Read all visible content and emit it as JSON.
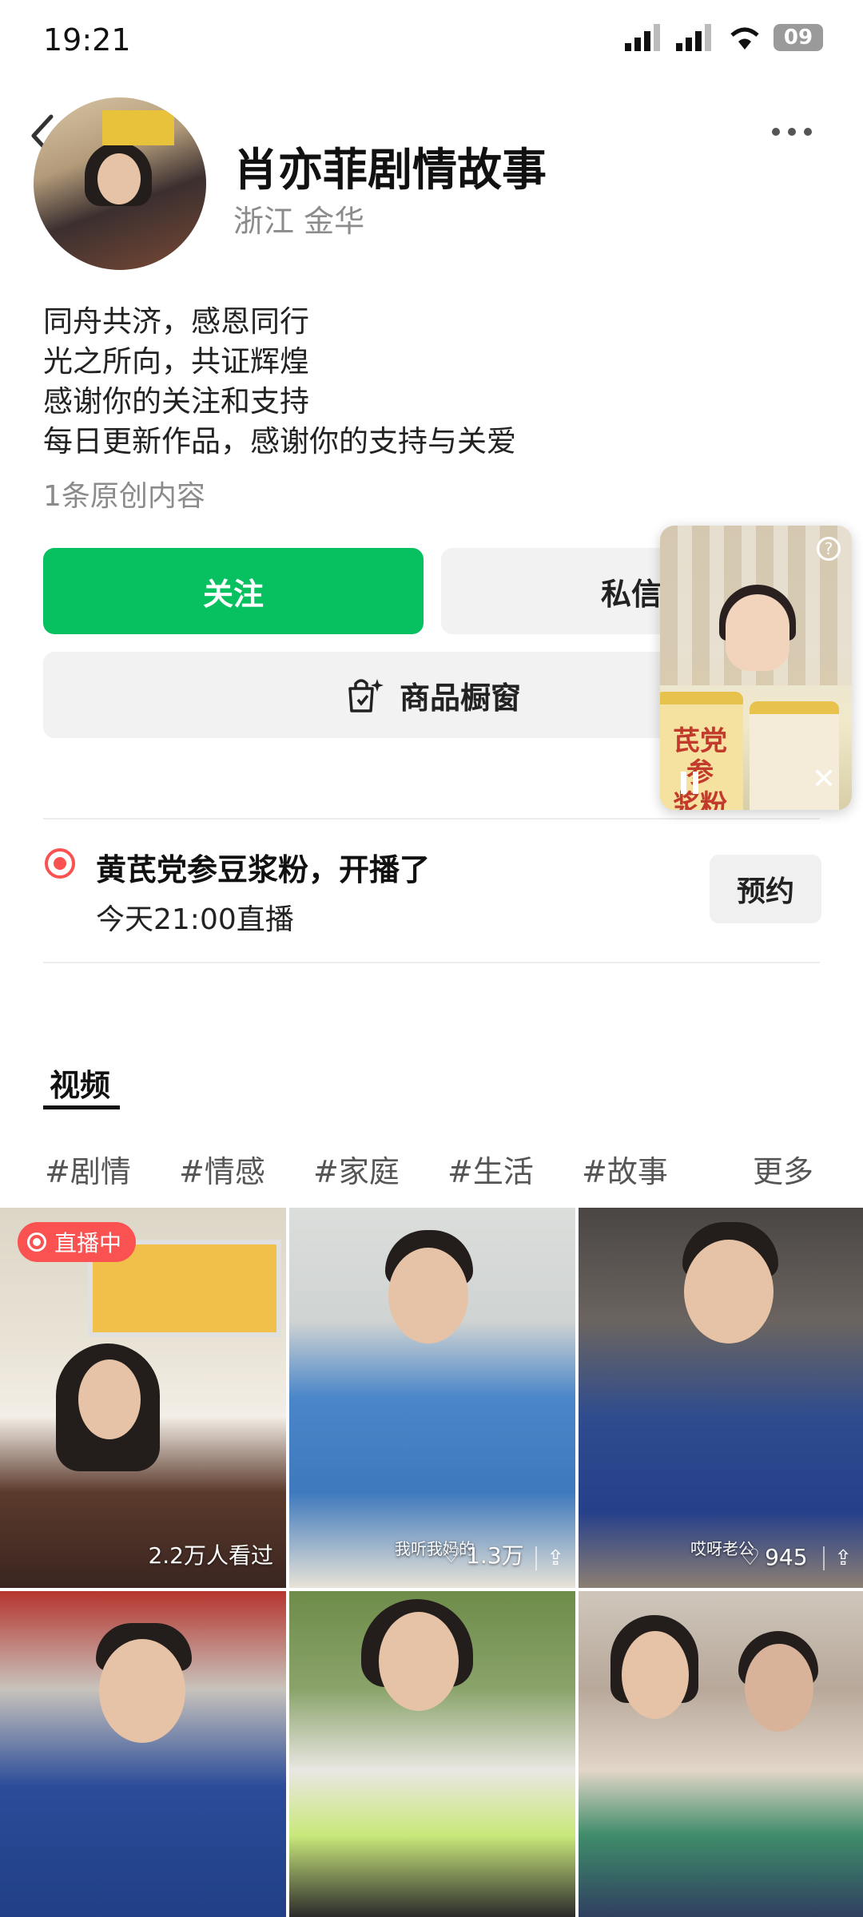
{
  "status_bar": {
    "time": "19:21",
    "battery": "09"
  },
  "profile": {
    "name": "肖亦菲剧情故事",
    "location": "浙江 金华",
    "bio": [
      "同舟共济，感恩同行",
      "光之所向，共证辉煌",
      "感谢你的关注和支持",
      "每日更新作品，感谢你的支持与关爱"
    ],
    "original_count": "1条原创内容"
  },
  "actions": {
    "follow": "关注",
    "message": "私信",
    "shop": "商品橱窗"
  },
  "live_notice": {
    "title": "黄芪党参豆浆粉，开播了",
    "time": "今天21:00直播",
    "reserve": "预约"
  },
  "pip": {
    "product_text": "芪党参\n浆粉"
  },
  "tabs": {
    "video": "视频"
  },
  "tags": [
    "#剧情",
    "#情感",
    "#家庭",
    "#生活",
    "#故事"
  ],
  "tags_more": "更多",
  "videos": [
    {
      "badge": "直播中",
      "views": "2.2万人看过"
    },
    {
      "caption": "我听我妈的",
      "likes": "1.3万"
    },
    {
      "caption": "哎呀老公",
      "likes": "945"
    },
    {},
    {},
    {}
  ],
  "colors": {
    "accent_green": "#07c160",
    "live_red": "#fa5151"
  }
}
